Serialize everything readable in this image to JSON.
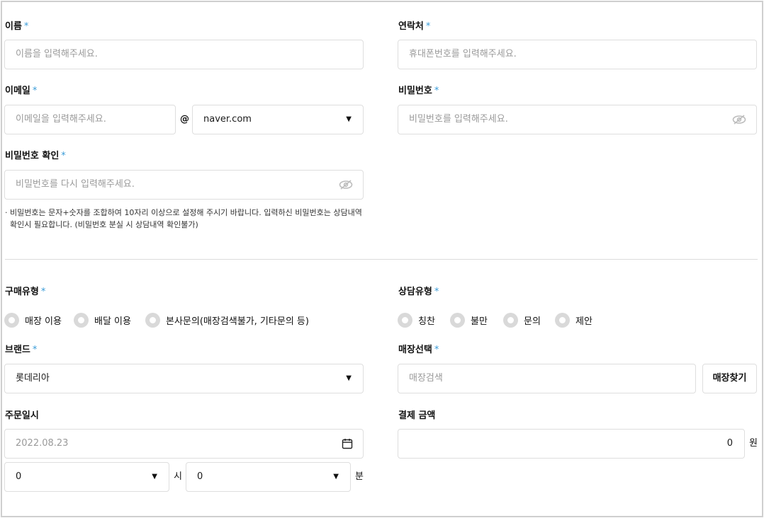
{
  "fields": {
    "name": {
      "label": "이름",
      "required_mark": "*",
      "placeholder": "이름을 입력해주세요."
    },
    "phone": {
      "label": "연락처",
      "required_mark": "*",
      "placeholder": "휴대폰번호를 입력해주세요."
    },
    "email": {
      "label": "이메일",
      "required_mark": "*",
      "placeholder": "이메일을 입력해주세요.",
      "at": "@",
      "domain": "naver.com"
    },
    "password": {
      "label": "비밀번호",
      "required_mark": "*",
      "placeholder": "비밀번호를 입력해주세요."
    },
    "password_confirm": {
      "label": "비밀번호 확인",
      "required_mark": "*",
      "placeholder": "비밀번호를 다시 입력해주세요."
    },
    "password_note_line1": "· 비밀번호는 문자+숫자를 조합하여 10자리 이상으로 설정해 주시기 바랍니다. 입력하신 비밀번호는 상담내역",
    "password_note_line2": "확인시 필요합니다. (비밀번호 분실 시 상담내역 확인불가)"
  },
  "purchase_type": {
    "label": "구매유형",
    "required_mark": "*",
    "options": [
      "매장 이용",
      "배달 이용",
      "본사문의(매장검색불가, 기타문의 등)"
    ]
  },
  "consult_type": {
    "label": "상담유형",
    "required_mark": "*",
    "options": [
      "칭찬",
      "불만",
      "문의",
      "제안"
    ]
  },
  "brand": {
    "label": "브랜드",
    "required_mark": "*",
    "value": "롯데리아"
  },
  "store": {
    "label": "매장선택",
    "required_mark": "*",
    "placeholder": "매장검색",
    "button": "매장찾기"
  },
  "order_datetime": {
    "label": "주문일시",
    "date": "2022.08.23",
    "hour": "0",
    "hour_unit": "시",
    "minute": "0",
    "minute_unit": "분"
  },
  "payment": {
    "label": "결제 금액",
    "value": "0",
    "unit": "원"
  },
  "icons": {
    "select_caret": "caret-down-icon",
    "password_toggle": "eye-slash-icon",
    "date_picker": "calendar-icon"
  },
  "colors": {
    "required": "#3a9cd8",
    "radio_off": "#d9d9d9",
    "border": "#dedede"
  }
}
